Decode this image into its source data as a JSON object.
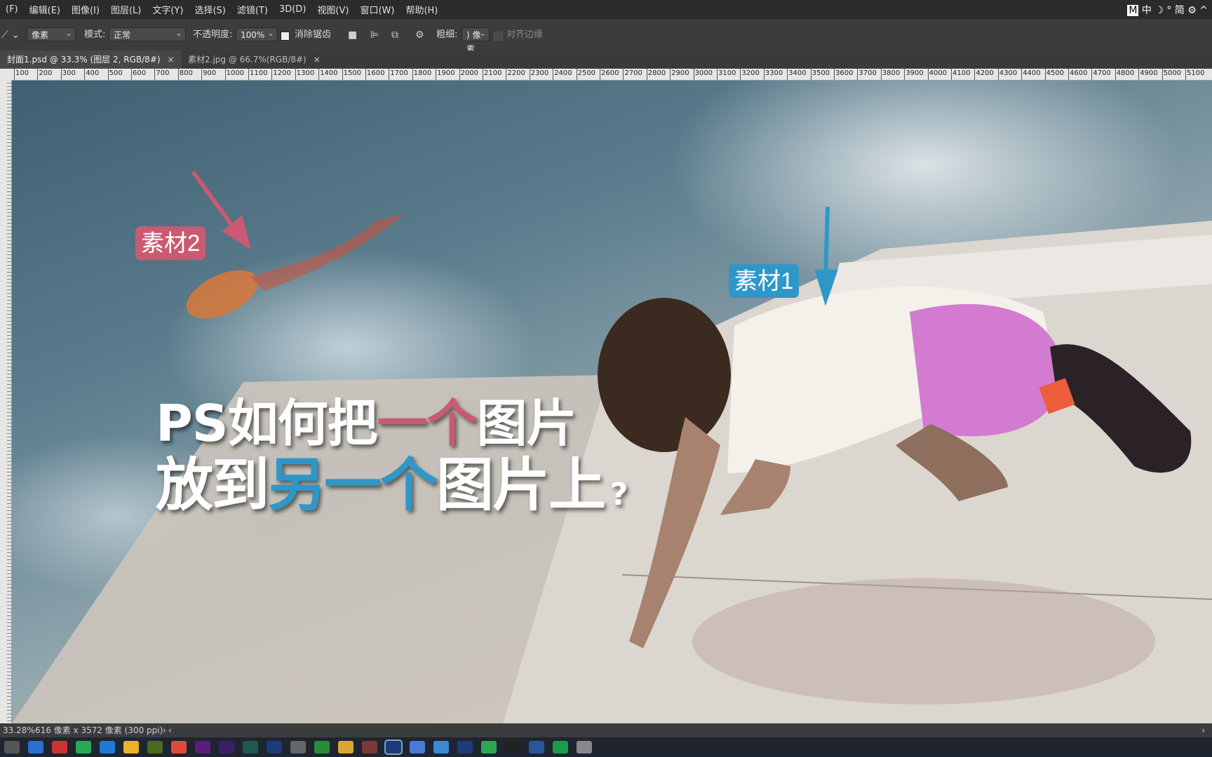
{
  "menu": [
    "(F)",
    "编辑(E)",
    "图像(I)",
    "图层(L)",
    "文字(Y)",
    "选择(S)",
    "滤镜(T)",
    "3D(D)",
    "视图(V)",
    "窗口(W)",
    "帮助(H)"
  ],
  "options": {
    "unit_select": "像素",
    "mode_label": "模式:",
    "mode_value": "正常",
    "opacity_label": "不透明度:",
    "opacity_value": "100%",
    "antialias_label": "消除锯齿",
    "width_label": "粗细:",
    "width_value": ") 像素",
    "align_edges_label": "对齐边缘"
  },
  "tabs": [
    {
      "label": "封面1.psd @ 33.3% (图层 2, RGB/8#)",
      "active": true
    },
    {
      "label": "素材2.jpg @ 66.7%(RGB/8#)",
      "active": false
    }
  ],
  "ruler_ticks": [
    "100",
    "200",
    "300",
    "400",
    "500",
    "600",
    "700",
    "800",
    "900",
    "1000",
    "1100",
    "1200",
    "1300",
    "1400",
    "1500",
    "1600",
    "1700",
    "1800",
    "1900",
    "2000",
    "2100",
    "2200",
    "2300",
    "2400",
    "2500",
    "2600",
    "2700",
    "2800",
    "2900",
    "3000",
    "3100",
    "3200",
    "3300",
    "3400",
    "3500",
    "3600",
    "3700",
    "3800",
    "3900",
    "4000",
    "4100",
    "4200",
    "4300",
    "4400",
    "4500",
    "4600",
    "4700",
    "4800",
    "4900",
    "5000",
    "5100"
  ],
  "canvas": {
    "tag_material2": "素材2",
    "tag_material1": "素材1",
    "headline_line1": {
      "a": "PS如何把",
      "b": "一个",
      "c": "图片"
    },
    "headline_line2": {
      "a": "放到",
      "b": "另一个",
      "c": "图片上",
      "d": "?"
    }
  },
  "status": {
    "zoom": "33.28%",
    "doc_size": "616 像素 x 3572 像素 (300 ppi)"
  },
  "taskbar_icons": [
    "start-icon",
    "browser-icon",
    "calculator-icon",
    "wechat-icon",
    "ucloud-icon",
    "gallery-icon",
    "dreamweaver-icon",
    "chrome-icon",
    "premiere-icon",
    "after-effects-icon",
    "audition-icon",
    "photoshop-icon",
    "capture-icon",
    "camtasia-icon",
    "folder-icon",
    "paint-icon",
    "photoshop-active-icon",
    "notes-icon",
    "link-icon",
    "photoshop2-icon",
    "green-app-icon",
    "capcut-icon",
    "word-icon",
    "video-icon",
    "notepad-icon"
  ],
  "tray": {
    "ime_m": "M",
    "ime_lang": "中",
    "ime_mode": "简"
  },
  "colors": {
    "pink": "#c95a72",
    "blue": "#2f97c8"
  }
}
